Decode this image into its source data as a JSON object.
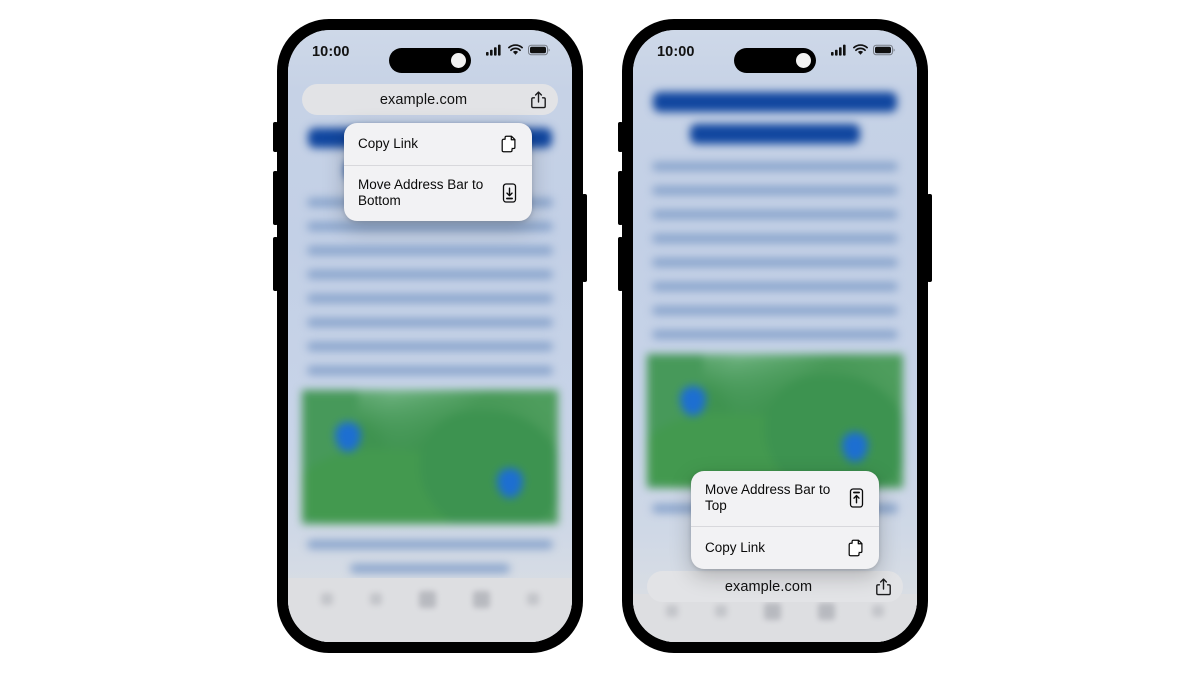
{
  "scene": {
    "description": "Two iPhone mockups side by side showing Safari address bar position options",
    "background_color": "#ffffff"
  },
  "phones": [
    {
      "id": "left",
      "address_bar_position": "top",
      "status_bar": {
        "time": "10:00",
        "icons": [
          "cellular-signal-icon",
          "wifi-icon",
          "battery-icon"
        ]
      },
      "address_bar": {
        "url": "example.com",
        "share_icon": "share-icon"
      },
      "context_menu": {
        "items": [
          {
            "label": "Copy Link",
            "icon": "copy-link-icon"
          },
          {
            "label": "Move Address Bar to Bottom",
            "icon": "move-address-bar-down-icon"
          }
        ]
      },
      "toolbar": {
        "icons": [
          "back-icon",
          "forward-icon",
          "share-icon",
          "bookmarks-icon",
          "tabs-icon"
        ]
      },
      "page_content": {
        "headings": [
          "",
          ""
        ],
        "body_lines": 8,
        "image": "map-image",
        "image_pins": 2,
        "trailing_lines": 2
      }
    },
    {
      "id": "right",
      "address_bar_position": "bottom",
      "status_bar": {
        "time": "10:00",
        "icons": [
          "cellular-signal-icon",
          "wifi-icon",
          "battery-icon"
        ]
      },
      "address_bar": {
        "url": "example.com",
        "share_icon": "share-icon"
      },
      "context_menu": {
        "items": [
          {
            "label": "Move Address Bar to Top",
            "icon": "move-address-bar-up-icon"
          },
          {
            "label": "Copy Link",
            "icon": "copy-link-icon"
          }
        ]
      },
      "toolbar": {
        "icons": [
          "back-icon",
          "forward-icon",
          "share-icon",
          "bookmarks-icon",
          "tabs-icon"
        ]
      },
      "page_content": {
        "headings": [
          "",
          ""
        ],
        "body_lines": 8,
        "image": "map-image",
        "image_pins": 2,
        "trailing_lines": 2
      }
    }
  ],
  "colors": {
    "heading_blue": "#10469f",
    "body_blue": "#7e9cc8",
    "map_green": "#43994f",
    "map_pin_blue": "#1d6fd1",
    "menu_background": "#f2f2f4",
    "address_bar_background": "#e2e3e6",
    "frame_black": "#000000"
  }
}
